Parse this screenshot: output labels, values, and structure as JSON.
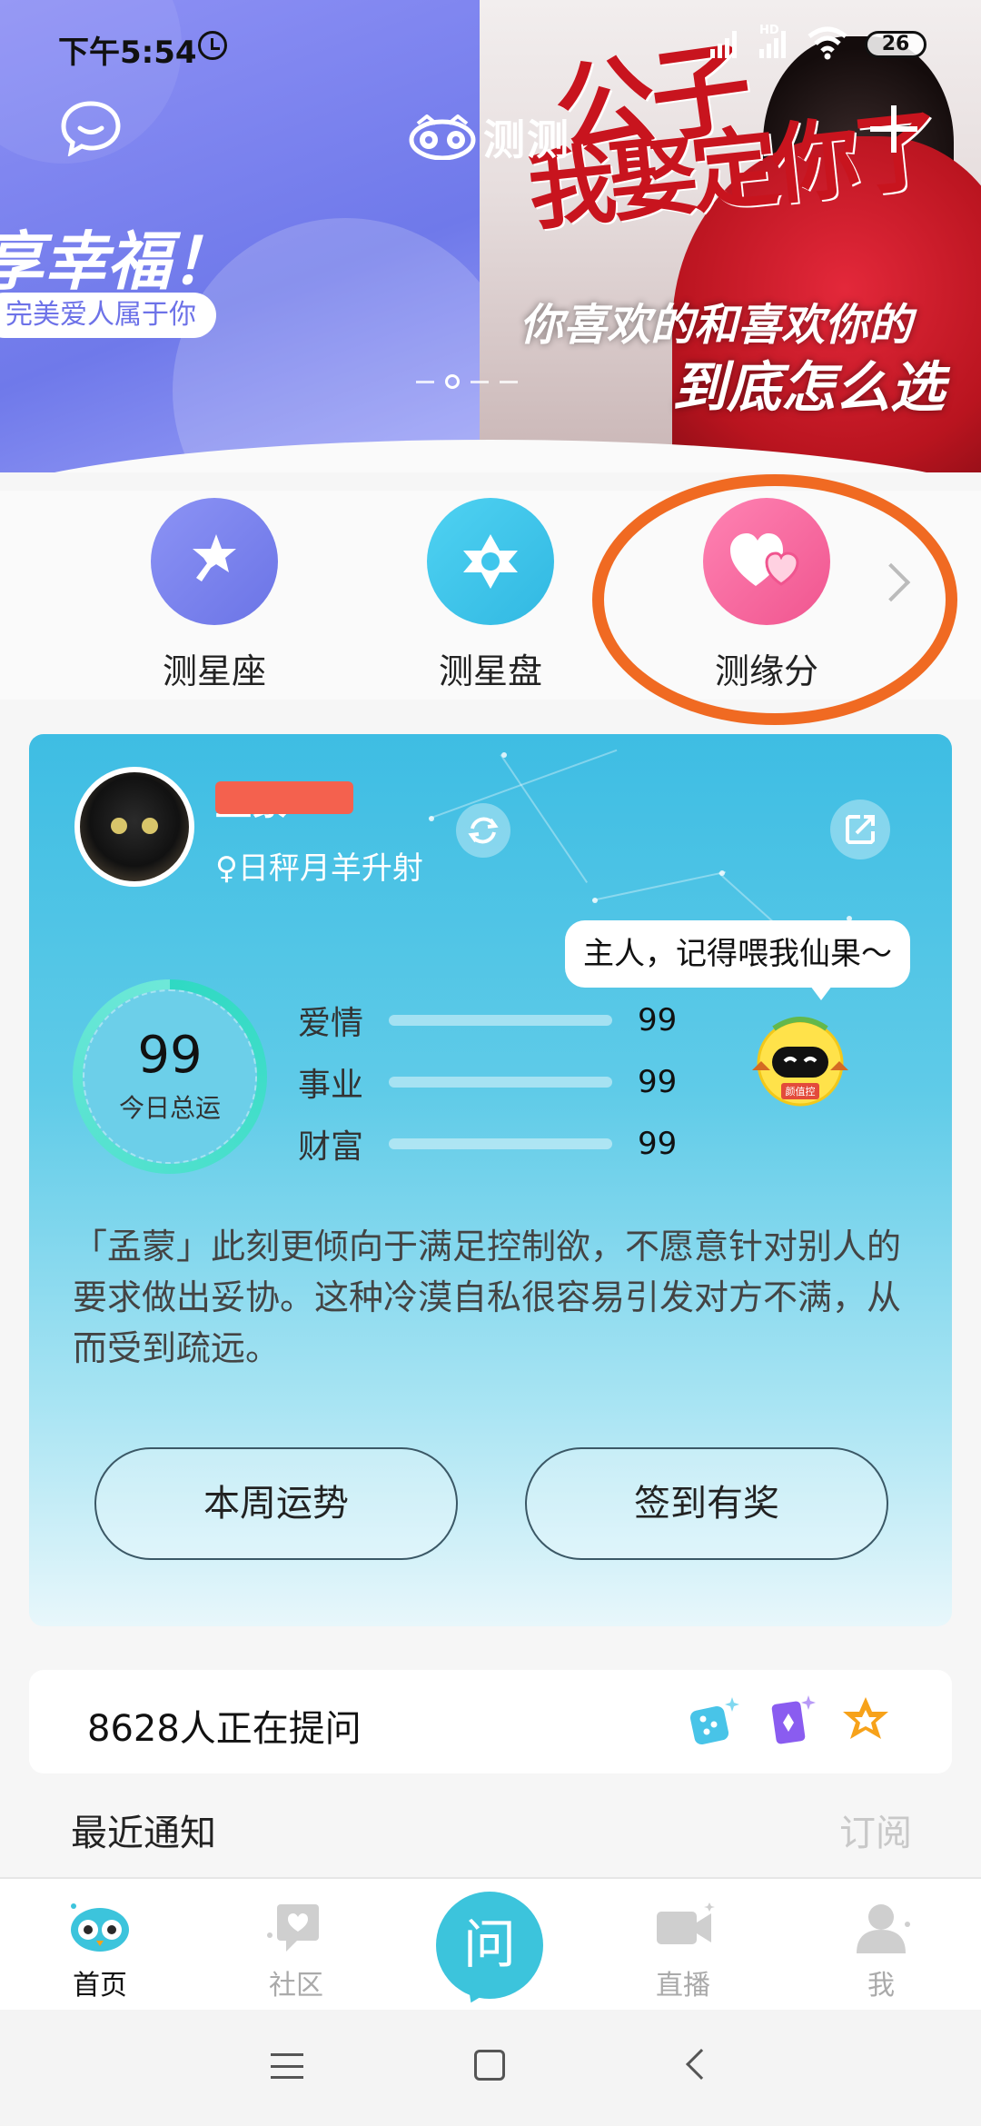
{
  "status_bar": {
    "time": "下午5:54",
    "hd_label": "HD",
    "battery": "26"
  },
  "header": {
    "brand_name": "测测"
  },
  "banner": {
    "left_slogan": "享幸福！",
    "left_pill": "完美爱人属于你",
    "poster_title_line1": "公子",
    "poster_title_line2": "我娶定你了",
    "poster_subtitle1": "你喜欢的和喜欢你的",
    "poster_subtitle2": "到底怎么选"
  },
  "quick_entries": [
    {
      "label": "测星座",
      "icon": "magic-wand-icon",
      "color": "#7b84f0"
    },
    {
      "label": "测星盘",
      "icon": "hexagram-icon",
      "color": "#3fc6ec"
    },
    {
      "label": "测缘分",
      "icon": "double-heart-icon",
      "color": "#f56aa1"
    }
  ],
  "fortune": {
    "user_name": "孟蒙",
    "zodiac_line": "♀日秤月羊升射",
    "score": "99",
    "score_label": "今日总运",
    "stats": [
      {
        "label": "爱情",
        "value": "99",
        "fraction": 0.99
      },
      {
        "label": "事业",
        "value": "99",
        "fraction": 0.99
      },
      {
        "label": "财富",
        "value": "99",
        "fraction": 0.99
      }
    ],
    "bubble": "主人，记得喂我仙果～",
    "mascot_badge": "颜值控",
    "description": "「孟蒙」此刻更倾向于满足控制欲，不愿意针对别人的要求做出妥协。这种冷漠自私很容易引发对方不满，从而受到疏远。",
    "btn_week": "本周运势",
    "btn_checkin": "签到有奖"
  },
  "asking": {
    "text": "8628人正在提问"
  },
  "notice": {
    "title": "最近通知",
    "subscribe": "订阅"
  },
  "tabs": [
    {
      "label": "首页",
      "icon": "owl-icon",
      "active": true
    },
    {
      "label": "社区",
      "icon": "community-icon",
      "active": false
    },
    {
      "label": "问",
      "icon": "ask-icon",
      "active": false
    },
    {
      "label": "直播",
      "icon": "video-icon",
      "active": false
    },
    {
      "label": "我",
      "icon": "person-icon",
      "active": false
    }
  ],
  "colors": {
    "accent": "#3cc4dc",
    "annotation": "#f06a22"
  }
}
